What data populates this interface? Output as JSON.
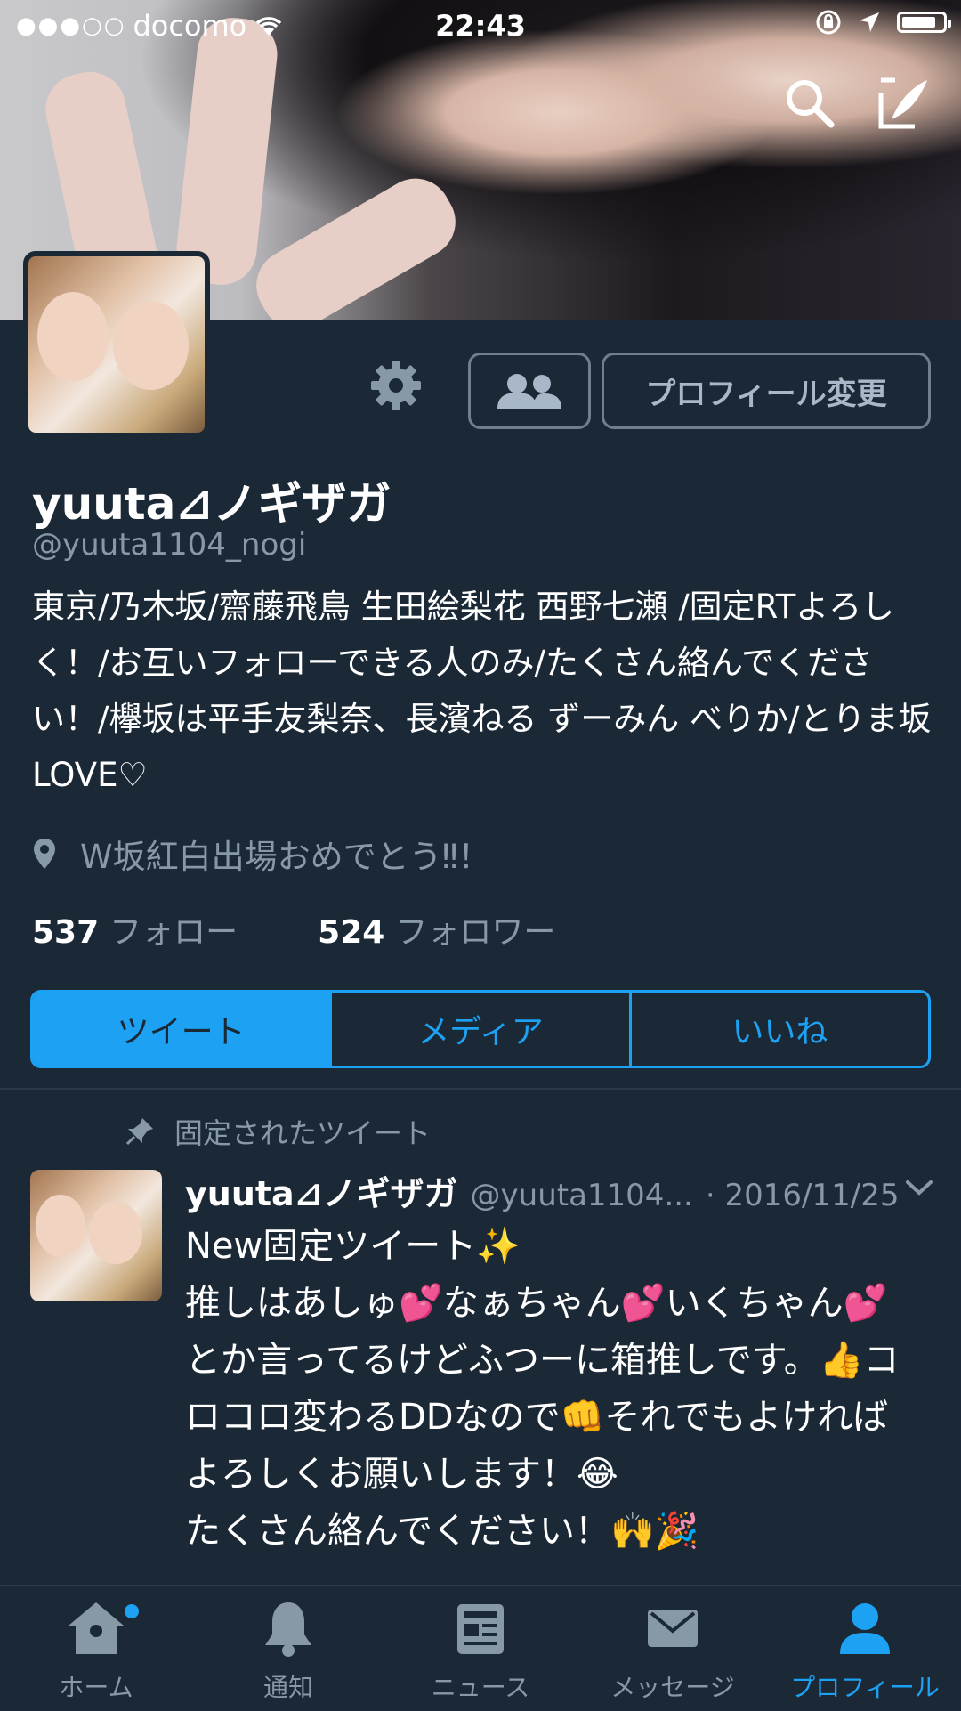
{
  "status_bar": {
    "signal_dots": "●●●○○",
    "carrier": "docomo",
    "time": "22:43",
    "battery_level": 0.85
  },
  "header": {
    "search_icon": "search-icon",
    "compose_icon": "compose-icon"
  },
  "profile": {
    "follow_icon": "people-icon",
    "edit_label": "プロフィール変更",
    "name": "yuuta⊿ノギザガ",
    "handle": "@yuuta1104_nogi",
    "bio": "東京/乃木坂/齋藤飛鳥 生田絵梨花 西野七瀬 /固定RTよろしく！/お互いフォローできる人のみ/たくさん絡んでください！/欅坂は平手友梨奈、長濱ねる ずーみん べりか/とりま坂LOVE♡",
    "location": "W坂紅白出場おめでとう‼！",
    "following_count": "537",
    "following_label": "フォロー",
    "followers_count": "524",
    "followers_label": "フォロワー"
  },
  "segments": [
    {
      "label": "ツイート",
      "active": true
    },
    {
      "label": "メディア",
      "active": false
    },
    {
      "label": "いいね",
      "active": false
    }
  ],
  "pinned_tweet": {
    "pinned_label": "固定されたツイート",
    "name": "yuuta⊿ノギザガ",
    "handle": "@yuuta1104...",
    "date": "· 2016/11/25",
    "body": "New固定ツイート✨\n推しはあしゅ💕なぁちゃん💕いくちゃん💕とか言ってるけどふつーに箱推しです。👍コロコロ変わるDDなので👊それでもよければよろしくお願いします！😂\nたくさん絡んでください！🙌🎉"
  },
  "tabbar": [
    {
      "label": "ホーム",
      "icon": "home-icon",
      "active": false
    },
    {
      "label": "通知",
      "icon": "bell-icon",
      "active": false
    },
    {
      "label": "ニュース",
      "icon": "news-icon",
      "active": false
    },
    {
      "label": "メッセージ",
      "icon": "mail-icon",
      "active": false
    },
    {
      "label": "プロフィール",
      "icon": "person-icon",
      "active": true
    }
  ],
  "colors": {
    "background": "#1b2836",
    "accent": "#1da1f2",
    "muted_text": "#8899a6"
  }
}
